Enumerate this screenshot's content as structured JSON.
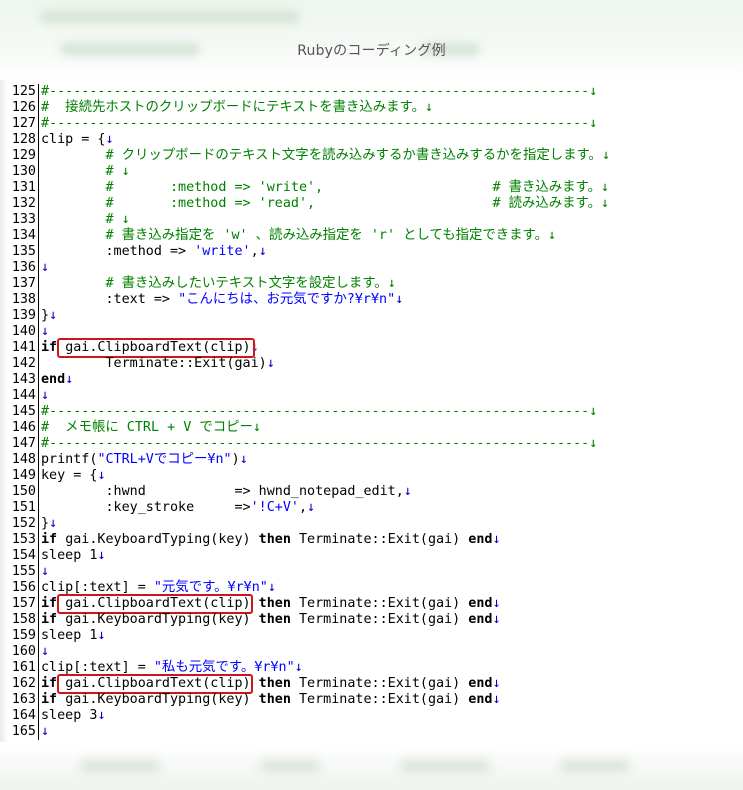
{
  "window": {
    "title": "Rubyのコーディング例"
  },
  "accent": {
    "highlight_border": "#d0141c",
    "comment": "#008000",
    "string": "#0000ff"
  },
  "eol_mark": "↓",
  "lines": [
    {
      "n": "125",
      "parts": [
        [
          "c",
          "#-------------------------------------------------------------------↓"
        ]
      ]
    },
    {
      "n": "126",
      "parts": [
        [
          "c",
          "#  接続先ホストのクリップボードにテキストを書き込みます。↓"
        ]
      ]
    },
    {
      "n": "127",
      "parts": [
        [
          "c",
          "#-------------------------------------------------------------------↓"
        ]
      ]
    },
    {
      "n": "128",
      "parts": [
        [
          "t",
          "clip = {"
        ],
        [
          "m",
          "↓"
        ]
      ]
    },
    {
      "n": "129",
      "parts": [
        [
          "t",
          "        "
        ],
        [
          "c",
          "# クリップボードのテキスト文字を読み込みするか書き込みするかを指定します。↓"
        ]
      ]
    },
    {
      "n": "130",
      "parts": [
        [
          "t",
          "        "
        ],
        [
          "c",
          "# ↓"
        ]
      ]
    },
    {
      "n": "131",
      "parts": [
        [
          "t",
          "        "
        ],
        [
          "c",
          "#       :method => 'write',                     # 書き込みます。↓"
        ]
      ]
    },
    {
      "n": "132",
      "parts": [
        [
          "t",
          "        "
        ],
        [
          "c",
          "#       :method => 'read',                      # 読み込みます。↓"
        ]
      ]
    },
    {
      "n": "133",
      "parts": [
        [
          "t",
          "        "
        ],
        [
          "c",
          "# ↓"
        ]
      ]
    },
    {
      "n": "134",
      "parts": [
        [
          "t",
          "        "
        ],
        [
          "c",
          "# 書き込み指定を 'w' 、読み込み指定を 'r' としても指定できます。↓"
        ]
      ]
    },
    {
      "n": "135",
      "parts": [
        [
          "t",
          "        :method => "
        ],
        [
          "s",
          "'write'"
        ],
        [
          "t",
          ","
        ],
        [
          "m",
          "↓"
        ]
      ]
    },
    {
      "n": "136",
      "parts": [
        [
          "m",
          "↓"
        ]
      ]
    },
    {
      "n": "137",
      "parts": [
        [
          "t",
          "        "
        ],
        [
          "c",
          "# 書き込みしたいテキスト文字を設定します。↓"
        ]
      ]
    },
    {
      "n": "138",
      "parts": [
        [
          "t",
          "        :text => "
        ],
        [
          "s",
          "\"こんにちは、お元気ですか?¥r¥n\""
        ],
        [
          "m",
          "↓"
        ]
      ]
    },
    {
      "n": "139",
      "parts": [
        [
          "t",
          "}"
        ],
        [
          "m",
          "↓"
        ]
      ]
    },
    {
      "n": "140",
      "parts": [
        [
          "m",
          "↓"
        ]
      ]
    },
    {
      "n": "141",
      "parts": [
        [
          "k",
          "if "
        ],
        [
          "t",
          "gai.ClipboardText(clip)"
        ],
        [
          "m",
          "↓"
        ]
      ]
    },
    {
      "n": "142",
      "parts": [
        [
          "t",
          "        Terminate::Exit(gai)"
        ],
        [
          "m",
          "↓"
        ]
      ]
    },
    {
      "n": "143",
      "parts": [
        [
          "k",
          "end"
        ],
        [
          "m",
          "↓"
        ]
      ]
    },
    {
      "n": "144",
      "parts": [
        [
          "m",
          "↓"
        ]
      ]
    },
    {
      "n": "145",
      "parts": [
        [
          "c",
          "#-------------------------------------------------------------------↓"
        ]
      ]
    },
    {
      "n": "146",
      "parts": [
        [
          "c",
          "#  メモ帳に CTRL + V でコピー↓"
        ]
      ]
    },
    {
      "n": "147",
      "parts": [
        [
          "c",
          "#-------------------------------------------------------------------↓"
        ]
      ]
    },
    {
      "n": "148",
      "parts": [
        [
          "t",
          "printf("
        ],
        [
          "s",
          "\"CTRL+Vでコピー¥n\""
        ],
        [
          "t",
          ")"
        ],
        [
          "m",
          "↓"
        ]
      ]
    },
    {
      "n": "149",
      "parts": [
        [
          "t",
          "key = {"
        ],
        [
          "m",
          "↓"
        ]
      ]
    },
    {
      "n": "150",
      "parts": [
        [
          "t",
          "        :hwnd           => hwnd_notepad_edit,"
        ],
        [
          "m",
          "↓"
        ]
      ]
    },
    {
      "n": "151",
      "parts": [
        [
          "t",
          "        :key_stroke     =>"
        ],
        [
          "s",
          "'!C+V'"
        ],
        [
          "t",
          ","
        ],
        [
          "m",
          "↓"
        ]
      ]
    },
    {
      "n": "152",
      "parts": [
        [
          "t",
          "}"
        ],
        [
          "m",
          "↓"
        ]
      ]
    },
    {
      "n": "153",
      "parts": [
        [
          "k",
          "if "
        ],
        [
          "t",
          "gai.KeyboardTyping(key) "
        ],
        [
          "k",
          "then "
        ],
        [
          "t",
          "Terminate::Exit(gai) "
        ],
        [
          "k",
          "end"
        ],
        [
          "m",
          "↓"
        ]
      ]
    },
    {
      "n": "154",
      "parts": [
        [
          "t",
          "sleep 1"
        ],
        [
          "m",
          "↓"
        ]
      ]
    },
    {
      "n": "155",
      "parts": [
        [
          "m",
          "↓"
        ]
      ]
    },
    {
      "n": "156",
      "parts": [
        [
          "t",
          "clip[:text] = "
        ],
        [
          "s",
          "\"元気です。¥r¥n\""
        ],
        [
          "m",
          "↓"
        ]
      ]
    },
    {
      "n": "157",
      "parts": [
        [
          "k",
          "if "
        ],
        [
          "t",
          "gai.ClipboardText(clip) "
        ],
        [
          "k",
          "then "
        ],
        [
          "t",
          "Terminate::Exit(gai) "
        ],
        [
          "k",
          "end"
        ],
        [
          "m",
          "↓"
        ]
      ]
    },
    {
      "n": "158",
      "parts": [
        [
          "k",
          "if "
        ],
        [
          "t",
          "gai.KeyboardTyping(key) "
        ],
        [
          "k",
          "then "
        ],
        [
          "t",
          "Terminate::Exit(gai) "
        ],
        [
          "k",
          "end"
        ],
        [
          "m",
          "↓"
        ]
      ]
    },
    {
      "n": "159",
      "parts": [
        [
          "t",
          "sleep 1"
        ],
        [
          "m",
          "↓"
        ]
      ]
    },
    {
      "n": "160",
      "parts": [
        [
          "m",
          "↓"
        ]
      ]
    },
    {
      "n": "161",
      "parts": [
        [
          "t",
          "clip[:text] = "
        ],
        [
          "s",
          "\"私も元気です。¥r¥n\""
        ],
        [
          "m",
          "↓"
        ]
      ]
    },
    {
      "n": "162",
      "parts": [
        [
          "k",
          "if "
        ],
        [
          "t",
          "gai.ClipboardText(clip) "
        ],
        [
          "k",
          "then "
        ],
        [
          "t",
          "Terminate::Exit(gai) "
        ],
        [
          "k",
          "end"
        ],
        [
          "m",
          "↓"
        ]
      ]
    },
    {
      "n": "163",
      "parts": [
        [
          "k",
          "if "
        ],
        [
          "t",
          "gai.KeyboardTyping(key) "
        ],
        [
          "k",
          "then "
        ],
        [
          "t",
          "Terminate::Exit(gai) "
        ],
        [
          "k",
          "end"
        ],
        [
          "m",
          "↓"
        ]
      ]
    },
    {
      "n": "164",
      "parts": [
        [
          "t",
          "sleep 3"
        ],
        [
          "m",
          "↓"
        ]
      ]
    },
    {
      "n": "165",
      "parts": [
        [
          "m",
          "↓"
        ]
      ]
    }
  ],
  "highlighted_lines": [
    "141",
    "157",
    "162"
  ]
}
